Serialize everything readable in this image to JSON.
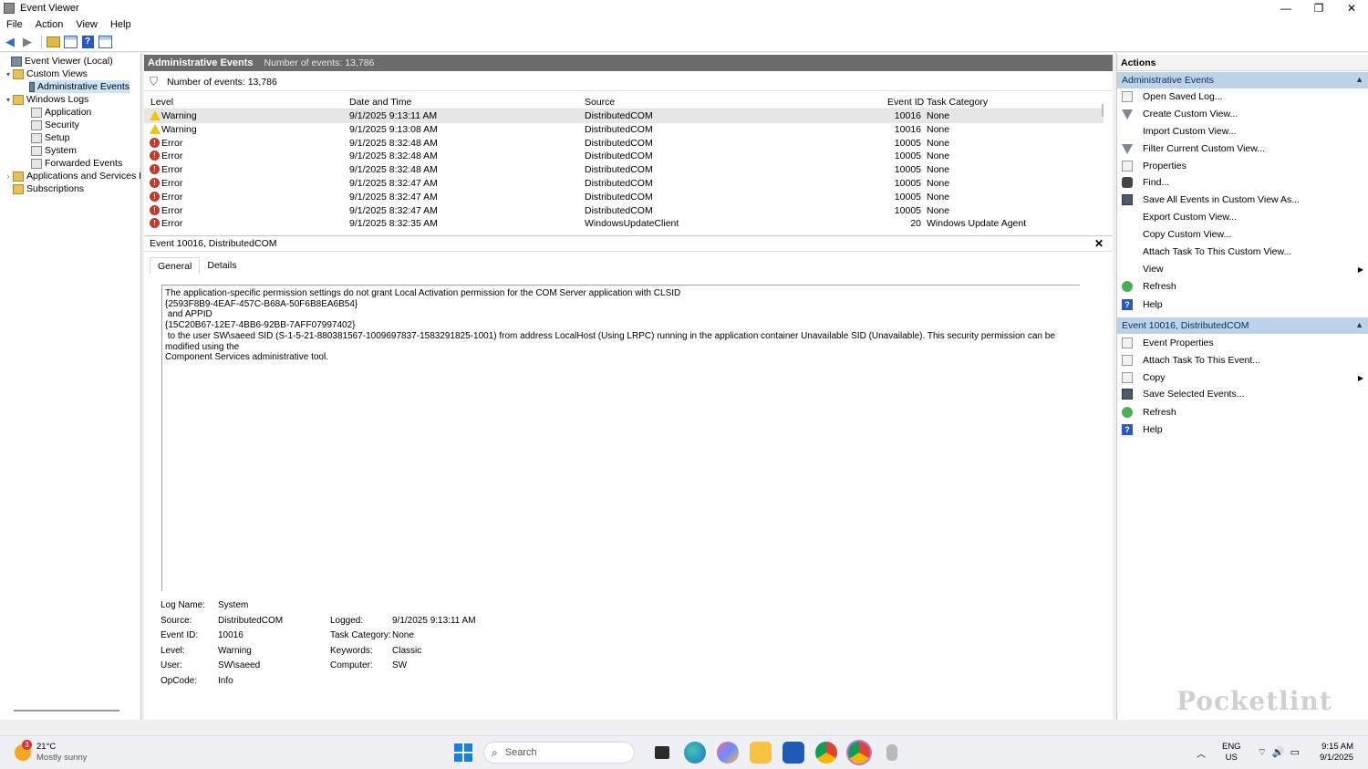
{
  "window": {
    "title": "Event Viewer",
    "controls": {
      "minimize": "—",
      "restore": "❐",
      "close": "✕"
    }
  },
  "menu": [
    "File",
    "Action",
    "View",
    "Help"
  ],
  "tree": [
    {
      "label": "Event Viewer (Local)",
      "icon": "event-viewer-icon"
    },
    {
      "label": "Custom Views",
      "icon": "folder-icon"
    },
    {
      "label": "Administrative Events",
      "icon": "filter-icon"
    },
    {
      "label": "Windows Logs",
      "icon": "folder-icon"
    },
    {
      "label": "Application",
      "icon": "log-icon"
    },
    {
      "label": "Security",
      "icon": "log-icon"
    },
    {
      "label": "Setup",
      "icon": "log-icon"
    },
    {
      "label": "System",
      "icon": "log-icon"
    },
    {
      "label": "Forwarded Events",
      "icon": "log-icon"
    },
    {
      "label": "Applications and Services Lo",
      "icon": "folder-icon"
    },
    {
      "label": "Subscriptions",
      "icon": "subscriptions-icon"
    }
  ],
  "center": {
    "header_title": "Administrative Events",
    "header_count": "Number of events: 13,786",
    "filter_text": "Number of events: 13,786",
    "columns": {
      "level": "Level",
      "date": "Date and Time",
      "source": "Source",
      "event_id": "Event ID",
      "category": "Task Category"
    },
    "rows": [
      {
        "level": "Warning",
        "date": "9/1/2025 9:13:11 AM",
        "source": "DistributedCOM",
        "event_id": "10016",
        "category": "None"
      },
      {
        "level": "Warning",
        "date": "9/1/2025 9:13:08 AM",
        "source": "DistributedCOM",
        "event_id": "10016",
        "category": "None"
      },
      {
        "level": "Error",
        "date": "9/1/2025 8:32:48 AM",
        "source": "DistributedCOM",
        "event_id": "10005",
        "category": "None"
      },
      {
        "level": "Error",
        "date": "9/1/2025 8:32:48 AM",
        "source": "DistributedCOM",
        "event_id": "10005",
        "category": "None"
      },
      {
        "level": "Error",
        "date": "9/1/2025 8:32:48 AM",
        "source": "DistributedCOM",
        "event_id": "10005",
        "category": "None"
      },
      {
        "level": "Error",
        "date": "9/1/2025 8:32:47 AM",
        "source": "DistributedCOM",
        "event_id": "10005",
        "category": "None"
      },
      {
        "level": "Error",
        "date": "9/1/2025 8:32:47 AM",
        "source": "DistributedCOM",
        "event_id": "10005",
        "category": "None"
      },
      {
        "level": "Error",
        "date": "9/1/2025 8:32:47 AM",
        "source": "DistributedCOM",
        "event_id": "10005",
        "category": "None"
      },
      {
        "level": "Error",
        "date": "9/1/2025 8:32:35 AM",
        "source": "WindowsUpdateClient",
        "event_id": "20",
        "category": "Windows Update Agent"
      }
    ],
    "detail_title": "Event 10016, DistributedCOM",
    "tabs": [
      "General",
      "Details"
    ],
    "message": "The application-specific permission settings do not grant Local Activation permission for the COM Server application with CLSID\n{2593F8B9-4EAF-457C-B68A-50F6B8EA6B54}\n and APPID\n{15C20B67-12E7-4BB6-92BB-7AFF07997402}\n to the user SW\\saeed SID (S-1-5-21-880381567-1009697837-1583291825-1001) from address LocalHost (Using LRPC) running in the application container Unavailable SID (Unavailable). This security permission can be modified using the\nComponent Services administrative tool.",
    "props": {
      "log_name_label": "Log Name:",
      "log_name": "System",
      "source_label": "Source:",
      "source": "DistributedCOM",
      "logged_label": "Logged:",
      "logged": "9/1/2025 9:13:11 AM",
      "event_id_label": "Event ID:",
      "event_id": "10016",
      "task_cat_label": "Task Category:",
      "task_cat": "None",
      "level_label": "Level:",
      "level": "Warning",
      "keywords_label": "Keywords:",
      "keywords": "Classic",
      "user_label": "User:",
      "user": "SW\\saeed",
      "computer_label": "Computer:",
      "computer": "SW",
      "opcode_label": "OpCode:",
      "opcode": "Info"
    }
  },
  "actions": {
    "title": "Actions",
    "section1": "Administrative Events",
    "items1": [
      {
        "label": "Open Saved Log...",
        "icon": "open-log-icon"
      },
      {
        "label": "Create Custom View...",
        "icon": "create-view-icon"
      },
      {
        "label": "Import Custom View...",
        "icon": "none"
      },
      {
        "label": "Filter Current Custom View...",
        "icon": "filter-icon"
      },
      {
        "label": "Properties",
        "icon": "properties-icon"
      },
      {
        "label": "Find...",
        "icon": "find-icon"
      },
      {
        "label": "Save All Events in Custom View As...",
        "icon": "save-icon"
      },
      {
        "label": "Export Custom View...",
        "icon": "none"
      },
      {
        "label": "Copy Custom View...",
        "icon": "none"
      },
      {
        "label": "Attach Task To This Custom View...",
        "icon": "none"
      },
      {
        "label": "View",
        "icon": "none"
      },
      {
        "label": "Refresh",
        "icon": "refresh-icon"
      },
      {
        "label": "Help",
        "icon": "help-icon"
      }
    ],
    "section2": "Event 10016, DistributedCOM",
    "items2": [
      {
        "label": "Event Properties",
        "icon": "properties-icon"
      },
      {
        "label": "Attach Task To This Event...",
        "icon": "task-icon"
      },
      {
        "label": "Copy",
        "icon": "copy-icon"
      },
      {
        "label": "Save Selected Events...",
        "icon": "save-icon"
      },
      {
        "label": "Refresh",
        "icon": "refresh-icon"
      },
      {
        "label": "Help",
        "icon": "help-icon"
      }
    ]
  },
  "watermark": "Pocketlint",
  "taskbar": {
    "weather_temp": "21°C",
    "weather_desc": "Mostly sunny",
    "weather_badge": "3",
    "search_placeholder": "Search",
    "lang_top": "ENG",
    "lang_bottom": "US",
    "time": "9:15 AM",
    "date": "9/1/2025"
  }
}
